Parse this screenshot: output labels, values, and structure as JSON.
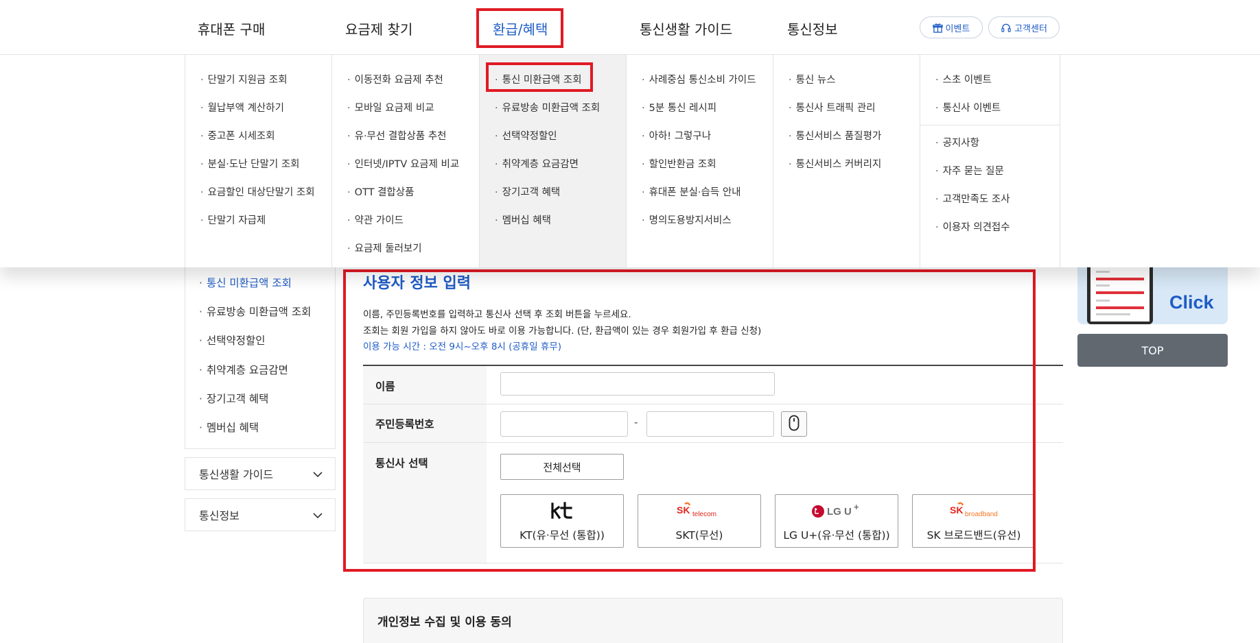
{
  "nav": {
    "items": [
      {
        "label": "휴대폰 구매",
        "active": false
      },
      {
        "label": "요금제 찾기",
        "active": false
      },
      {
        "label": "환급/혜택",
        "active": true
      },
      {
        "label": "통신생활 가이드",
        "active": false
      },
      {
        "label": "통신정보",
        "active": false
      }
    ],
    "event_label": "이벤트",
    "support_label": "고객센터"
  },
  "mega_menu": {
    "columns": [
      {
        "items": [
          "단말기 지원금 조회",
          "월납부액 계산하기",
          "중고폰 시세조회",
          "분실·도난 단말기 조회",
          "요금할인 대상단말기 조회",
          "단말기 자급제"
        ]
      },
      {
        "items": [
          "이동전화 요금제 추천",
          "모바일 요금제 비교",
          "유·무선 결합상품 추천",
          "인터넷/IPTV 요금제 비교",
          "OTT 결합상품",
          "약관 가이드",
          "요금제 둘러보기"
        ]
      },
      {
        "items": [
          "통신 미환급액 조회",
          "유료방송 미환급액 조회",
          "선택약정할인",
          "취약계층 요금감면",
          "장기고객 혜택",
          "멤버십 혜택"
        ]
      },
      {
        "items": [
          "사례중심 통신소비 가이드",
          "5분 통신 레시피",
          "아하! 그렇구나",
          "할인반환금 조회",
          "휴대폰 분실·습득 안내",
          "명의도용방지서비스"
        ]
      },
      {
        "items": [
          "통신 뉴스",
          "통신사 트래픽 관리",
          "통신서비스 품질평가",
          "통신서비스 커버리지"
        ]
      },
      {
        "items": [
          "스초 이벤트",
          "통신사 이벤트",
          "공지사항",
          "자주 묻는 질문",
          "고객만족도 조사",
          "이용자 의견접수"
        ]
      }
    ]
  },
  "sidebar": {
    "items": [
      {
        "label": "통신 미환급액 조회",
        "active": true
      },
      {
        "label": "유료방송 미환급액 조회",
        "active": false
      },
      {
        "label": "선택약정할인",
        "active": false
      },
      {
        "label": "취약계층 요금감면",
        "active": false
      },
      {
        "label": "장기고객 혜택",
        "active": false
      },
      {
        "label": "멤버십 혜택",
        "active": false
      }
    ],
    "accordions": [
      "통신생활 가이드",
      "통신정보"
    ]
  },
  "form": {
    "title": "사용자 정보 입력",
    "desc_line1": "이름, 주민등록번호를 입력하고 통신사 선택 후 조회 버튼을 누르세요.",
    "desc_line2": "조회는 회원 가입을 하지 않아도 바로 이용 가능합니다. (단, 환급액이 있는 경우 회원가입 후 환급 신청)",
    "hours": "이용 가능 시간 : 오전 9시~오후 8시 (공휴일 휴무)",
    "name_label": "이름",
    "name_value": "",
    "rrn_label": "주민등록번호",
    "rrn_first_value": "",
    "rrn_second_value": "",
    "rrn_separator": "-",
    "carrier_label": "통신사 선택",
    "select_all": "전체선택",
    "carriers": [
      {
        "logo": "kt",
        "name": "KT(유·무선 (통합))"
      },
      {
        "logo": "SK telecom",
        "name": "SKT(무선)"
      },
      {
        "logo": "LG U+",
        "name": "LG U+(유·무선 (통합))"
      },
      {
        "logo": "SK broadband",
        "name": "SK 브로드밴드(유선)"
      }
    ]
  },
  "consent": {
    "title": "개인정보 수집 및 이용 동의"
  },
  "banner": {
    "click_text": "Click"
  },
  "top_button": "TOP",
  "colors": {
    "accent": "#1e5bc6",
    "highlight": "#e01a24",
    "top_button": "#616870"
  }
}
